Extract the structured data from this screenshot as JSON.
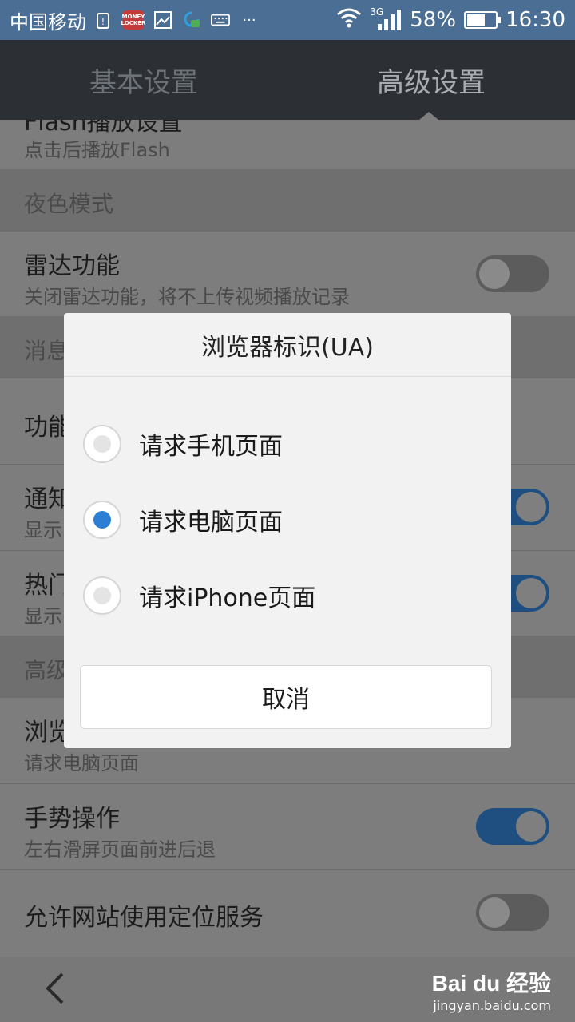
{
  "status_bar": {
    "carrier": "中国移动",
    "money_locker_label": "MONEY LOCKER",
    "more": "···",
    "network": "3G",
    "battery": "58%",
    "time": "16:30"
  },
  "tabs": [
    {
      "label": "基本设置",
      "active": false
    },
    {
      "label": "高级设置",
      "active": true
    }
  ],
  "settings": {
    "flash": {
      "title": "Flash播放设置",
      "subtitle": "点击后播放Flash"
    },
    "section_night": "夜色模式",
    "radar": {
      "title": "雷达功能",
      "subtitle": "关闭雷达功能，将不上传视频播放记录",
      "enabled": false
    },
    "section_message": "消息",
    "function": {
      "title": "功能"
    },
    "notify": {
      "title": "通知",
      "subtitle": "显示",
      "enabled": true
    },
    "hot": {
      "title": "热门",
      "subtitle": "显示",
      "enabled": true
    },
    "section_advanced": "高级",
    "browser_ua": {
      "title": "浏览",
      "subtitle": "请求电脑页面"
    },
    "gesture": {
      "title": "手势操作",
      "subtitle": "左右滑屏页面前进后退",
      "enabled": true
    },
    "location": {
      "title": "允许网站使用定位服务",
      "enabled": false
    }
  },
  "dialog": {
    "title": "浏览器标识(UA)",
    "options": [
      {
        "label": "请求手机页面",
        "checked": false
      },
      {
        "label": "请求电脑页面",
        "checked": true
      },
      {
        "label": "请求iPhone页面",
        "checked": false
      }
    ],
    "cancel_label": "取消"
  },
  "watermark": {
    "main": "Bai du 经验",
    "sub": "jingyan.baidu.com"
  },
  "colors": {
    "accent": "#2d7fd5",
    "header": "#2c3035",
    "status_bar": "#4b6f94"
  }
}
